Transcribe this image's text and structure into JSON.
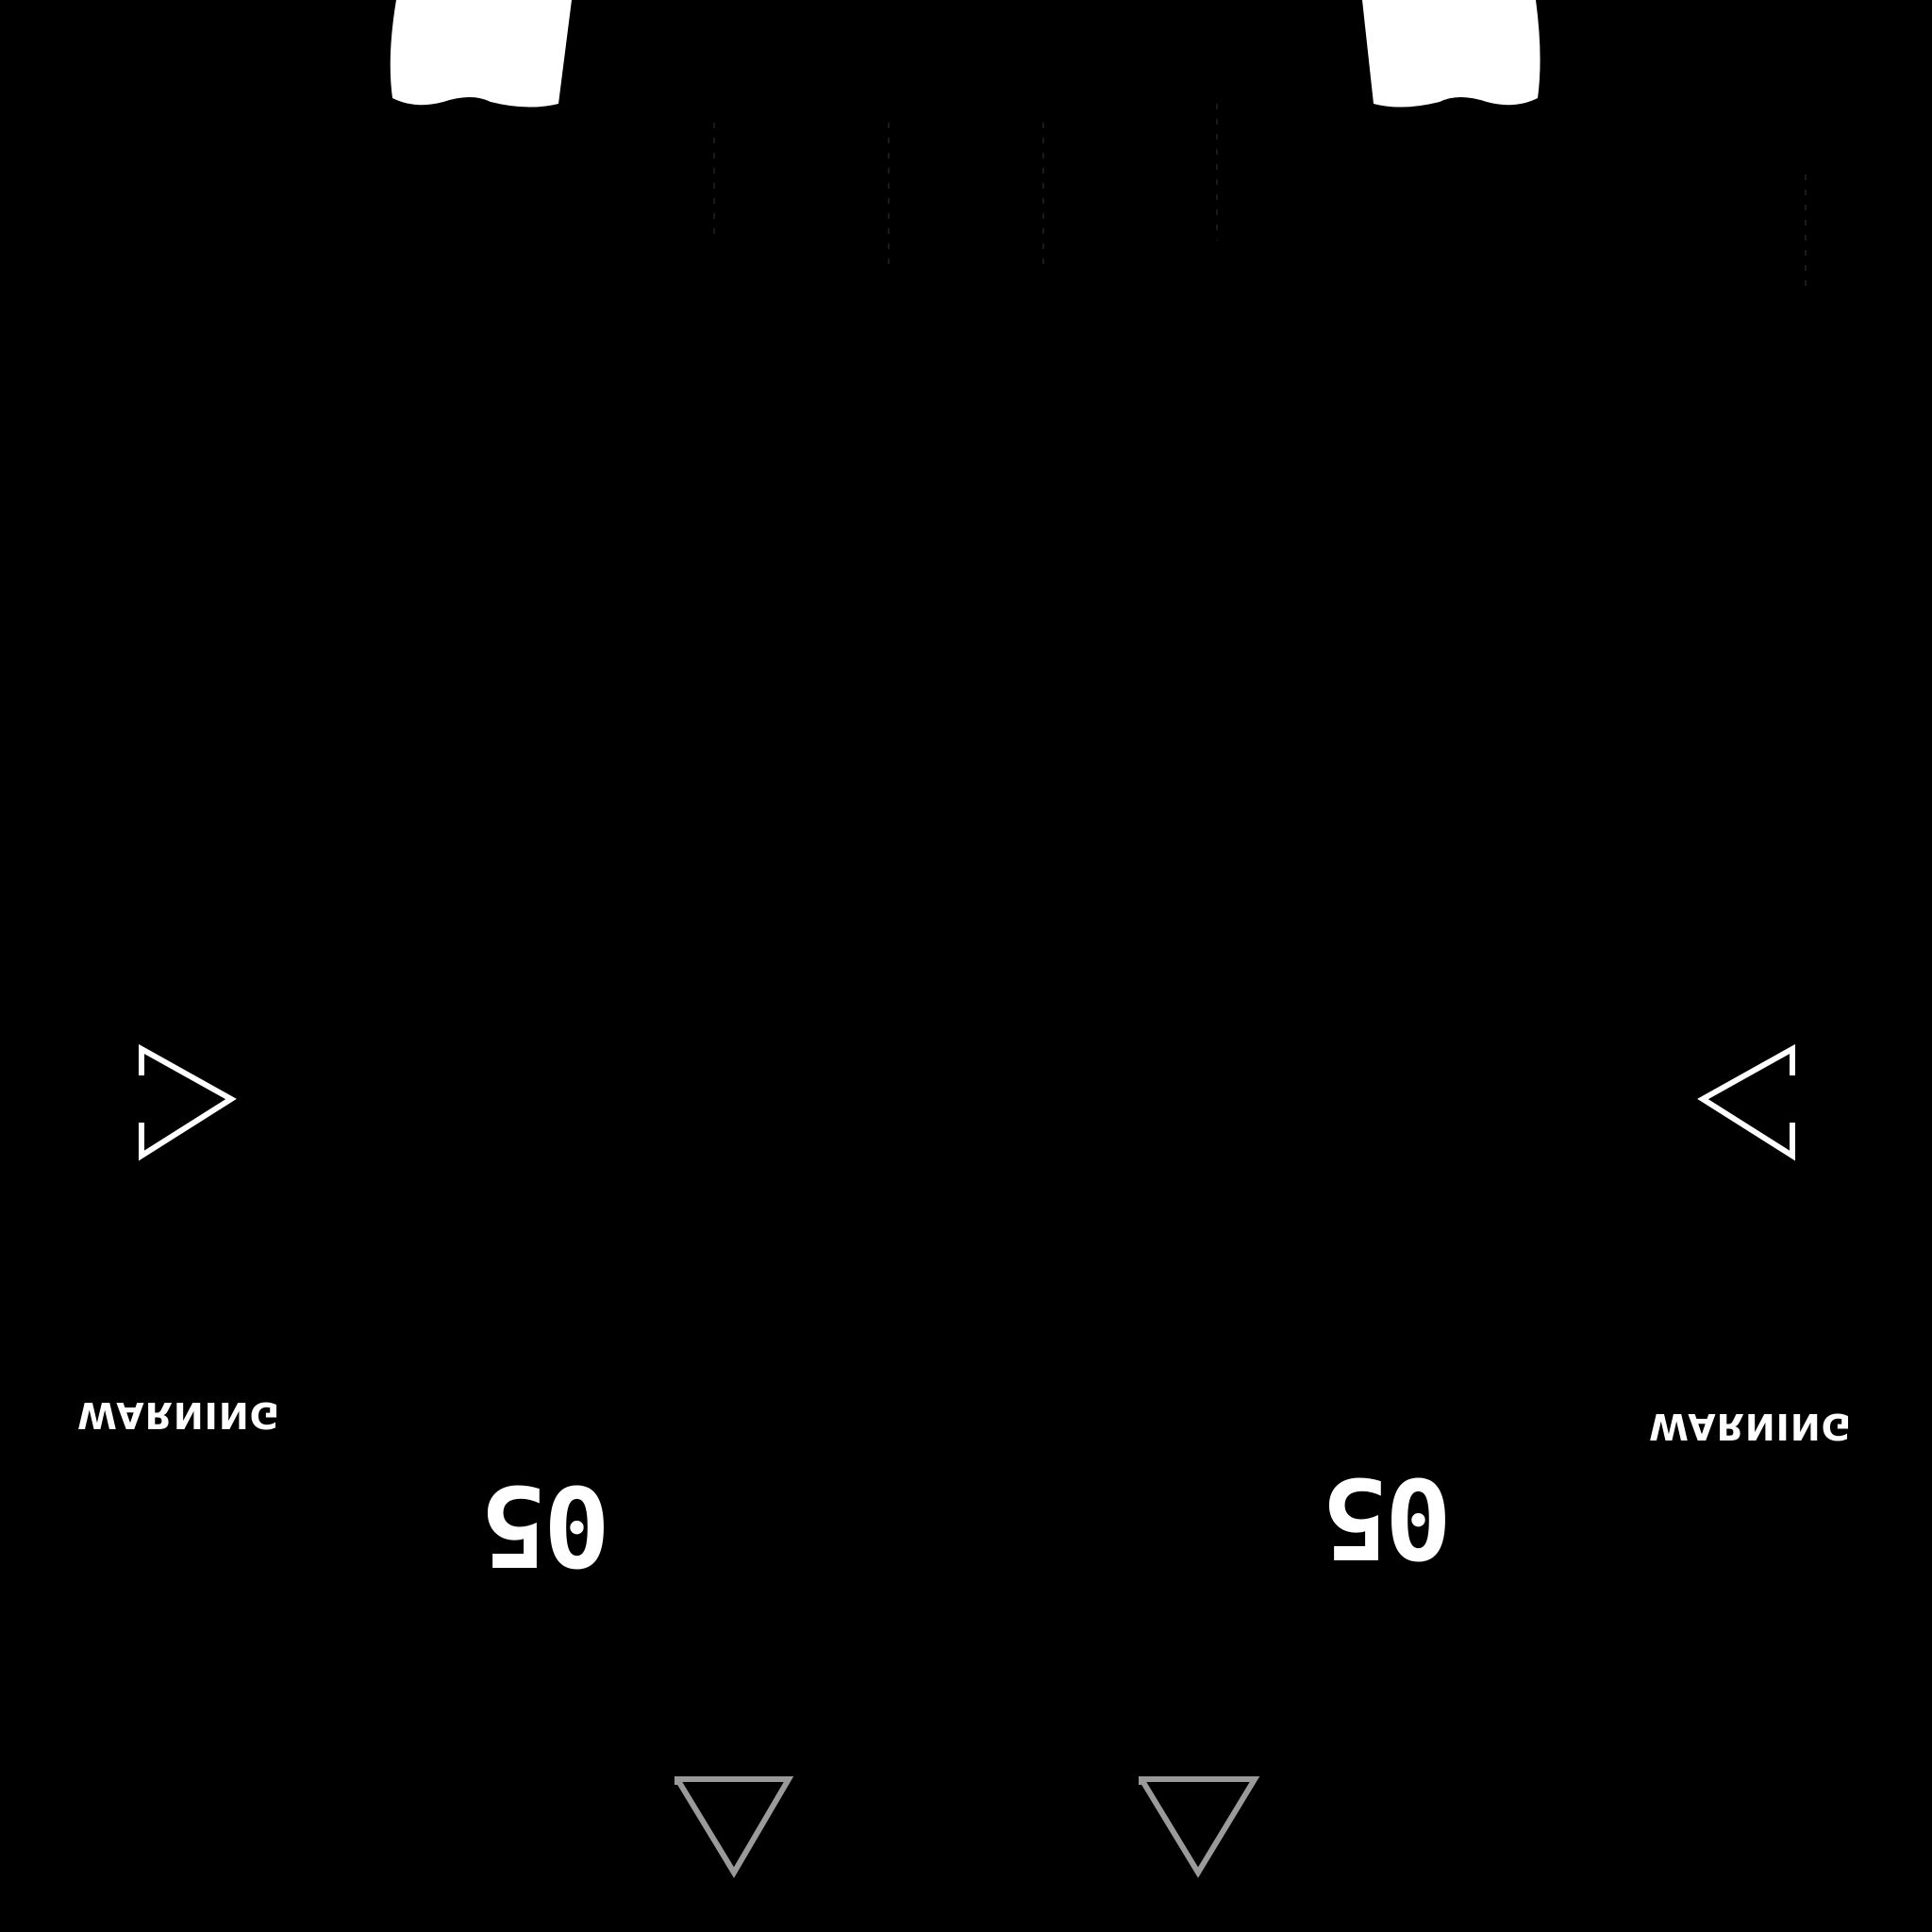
{
  "texture": {
    "background_color": "#000000",
    "foreground_color": "#ffffff",
    "secondary_color": "#9a9a9a",
    "labels": {
      "warning_left": "WARNING",
      "warning_right": "WARNING",
      "number_left": "05",
      "number_right": "05"
    },
    "icons": {
      "arrow_left_panel": "triangle-arrow-right-icon",
      "arrow_right_panel": "triangle-arrow-left-icon",
      "arrow_bottom_left": "triangle-arrow-down-icon",
      "arrow_bottom_right": "triangle-arrow-down-icon"
    }
  }
}
